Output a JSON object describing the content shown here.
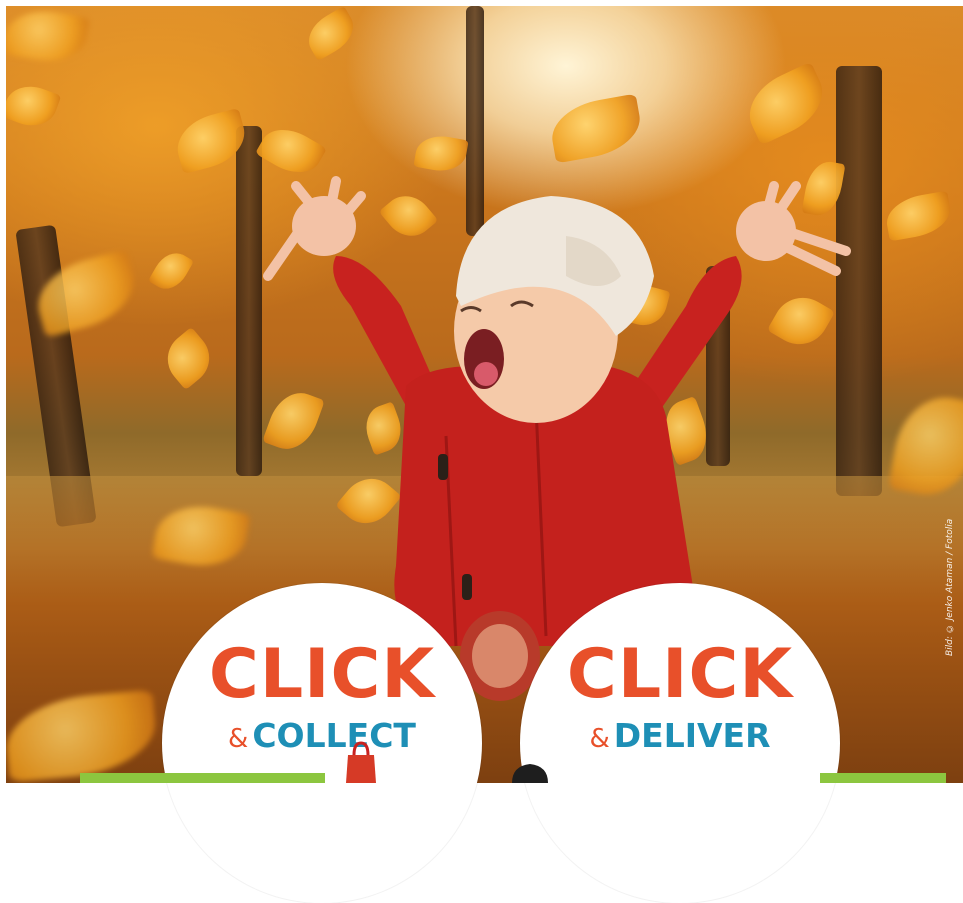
{
  "photo": {
    "description_icon": "autumn-child-photo",
    "credit": "Bild: © Jenko Ataman / Fotolia"
  },
  "badges": [
    {
      "click": "CLICK",
      "amp": "&",
      "service": "COLLECT"
    },
    {
      "click": "CLICK",
      "amp": "&",
      "service": "DELIVER"
    }
  ],
  "colors": {
    "click_orange": "#e8502a",
    "service_blue": "#1e8fb6",
    "accent_green": "#8cc63f"
  },
  "icons": [
    "shopping-bag-icon",
    "car-icon"
  ]
}
